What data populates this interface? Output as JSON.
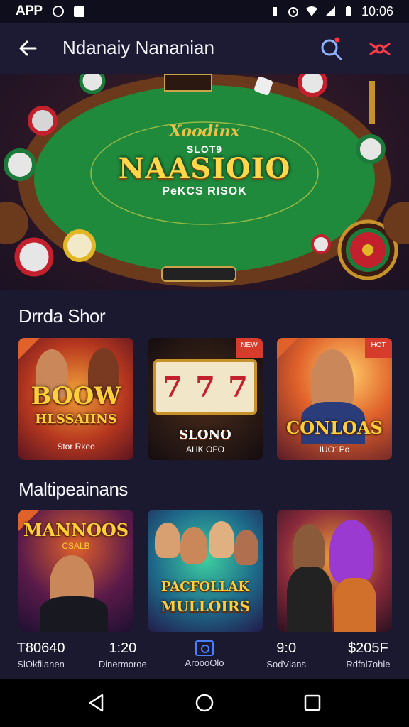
{
  "status_bar": {
    "app_label": "APP",
    "time": "10:06"
  },
  "app_bar": {
    "title": "Ndanaiy Nananian"
  },
  "hero": {
    "kicker": "Xoodinx",
    "sub": "SLOT9",
    "title": "NAASIOIO",
    "tagline": "PeKCS RISOK"
  },
  "sections": {
    "first_title": "Drrda Shor",
    "second_title": "Maltipeainans"
  },
  "cards_row1": [
    {
      "title": "BOOW",
      "title2": "HLSSAIINS",
      "sub": "Stor Rkeo",
      "badge": ""
    },
    {
      "title": "SLONO",
      "sub": "AHK OFO",
      "badge": "NEW"
    },
    {
      "title": "CONLOAS",
      "sub": "IUO1Po",
      "badge": "HOT"
    }
  ],
  "cards_row2": [
    {
      "title": "MANNOOS",
      "sub": "CSALB"
    },
    {
      "title": "PACFOLLAK",
      "title2": "MULLOIRS",
      "sub": ""
    },
    {
      "title": "",
      "sub": ""
    }
  ],
  "tabbar": [
    {
      "value": "T80640",
      "label": "SlOkfilanen"
    },
    {
      "value": "1:20",
      "label": "Dinermoroe"
    },
    {
      "value": "",
      "label": "AroooOlo"
    },
    {
      "value": "9:0",
      "label": "SodVlans"
    },
    {
      "value": "$205F",
      "label": "Rdfal7ohle"
    }
  ],
  "colors": {
    "background": "#1b1930",
    "appbar": "#1d1b33",
    "accent_gold": "#ffd84a",
    "felt_green": "#1f8a3c",
    "badge_red": "#d63b2b",
    "active_tab": "#4a7dff"
  },
  "icons": [
    "back-arrow-icon",
    "search-icon",
    "filter-icon",
    "nav-back-icon",
    "nav-home-icon",
    "nav-recents-icon"
  ]
}
